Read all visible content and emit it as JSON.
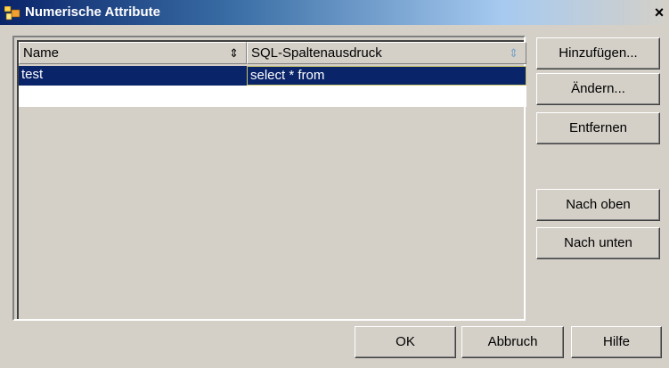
{
  "window": {
    "title": "Numerische Attribute",
    "close_symbol": "×",
    "icon": "app-window-icon"
  },
  "table": {
    "columns": [
      {
        "label": "Name",
        "sort_icon": "⇕"
      },
      {
        "label": "SQL-Spaltenausdruck",
        "sort_icon": "⇕"
      }
    ],
    "rows": [
      {
        "name": "test",
        "sql": "select * from",
        "selected": true
      }
    ]
  },
  "side_buttons": {
    "add": "Hinzufügen...",
    "edit": "Ändern...",
    "remove": "Entfernen",
    "move_up": "Nach oben",
    "move_down": "Nach unten"
  },
  "bottom_buttons": {
    "ok": "OK",
    "cancel": "Abbruch",
    "help": "Hilfe"
  },
  "colors": {
    "dialog_bg": "#d4d0c8",
    "selection_bg": "#0a246a",
    "selection_text": "#ffffff",
    "titlebar_start": "#0a246a",
    "titlebar_end": "#a6caf0"
  }
}
